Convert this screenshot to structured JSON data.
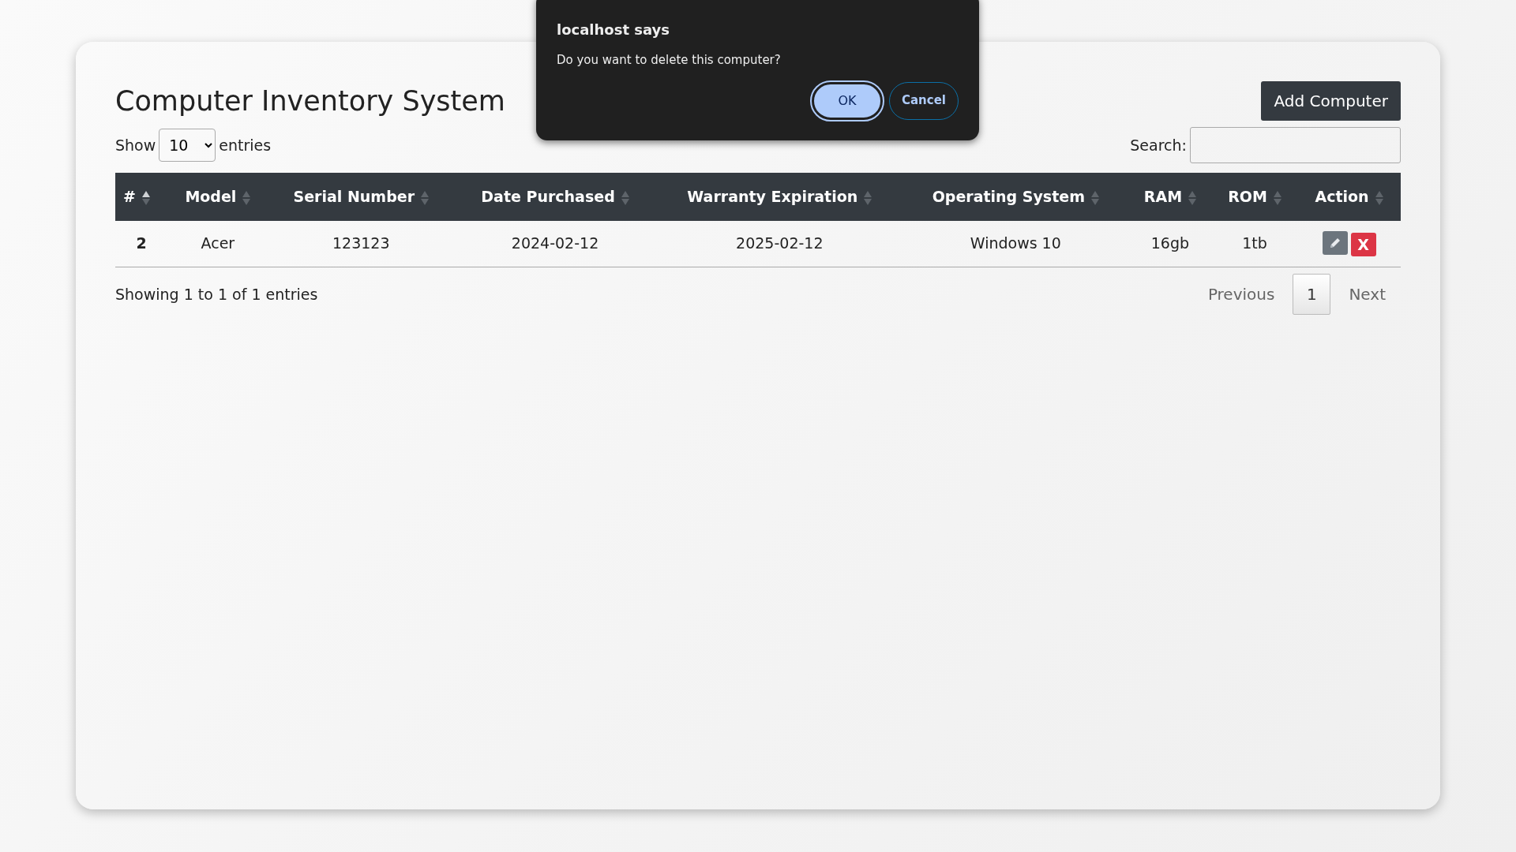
{
  "page": {
    "title": "Computer Inventory System",
    "add_button": "Add Computer"
  },
  "length_menu": {
    "before": "Show",
    "value": "10",
    "after": "entries"
  },
  "search": {
    "label": "Search:"
  },
  "table": {
    "columns": [
      {
        "label": "#",
        "sorted": true
      },
      {
        "label": "Model",
        "sorted": false
      },
      {
        "label": "Serial Number",
        "sorted": false
      },
      {
        "label": "Date Purchased",
        "sorted": false
      },
      {
        "label": "Warranty Expiration",
        "sorted": false
      },
      {
        "label": "Operating System",
        "sorted": false
      },
      {
        "label": "RAM",
        "sorted": false
      },
      {
        "label": "ROM",
        "sorted": false
      },
      {
        "label": "Action",
        "sorted": false
      }
    ],
    "rows": [
      {
        "cells": [
          "2",
          "Acer",
          "123123",
          "2024-02-12",
          "2025-02-12",
          "Windows 10",
          "16gb",
          "1tb"
        ],
        "delete_label": "X"
      }
    ]
  },
  "info": "Showing 1 to 1 of 1 entries",
  "pagination": [
    {
      "label": "Previous",
      "kind": "nav",
      "selected": false
    },
    {
      "label": "1",
      "kind": "page",
      "selected": true
    },
    {
      "label": "Next",
      "kind": "nav",
      "selected": false
    }
  ],
  "dialog": {
    "title": "localhost says",
    "message": "Do you want to delete this computer?",
    "buttons": [
      {
        "label": "OK",
        "kind": "primary"
      },
      {
        "label": "Cancel",
        "kind": "secondary"
      }
    ]
  }
}
